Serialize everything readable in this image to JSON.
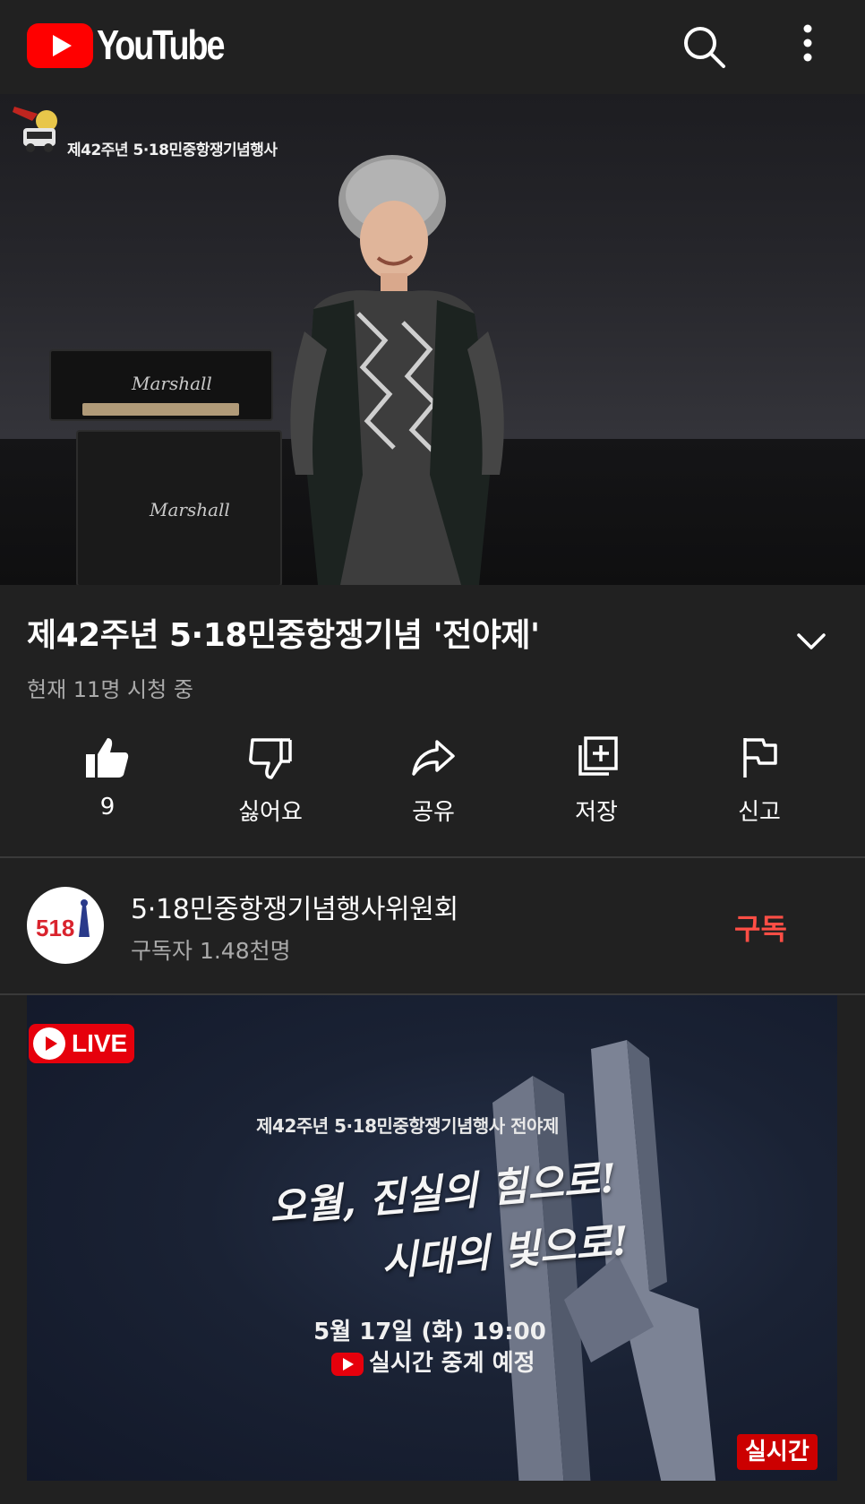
{
  "header": {
    "app_name": "YouTube",
    "logo_icon": "youtube-play-icon",
    "search_icon": "search-icon",
    "more_icon": "more-vert-icon",
    "brand_color": "#ff0000"
  },
  "player": {
    "overlay_caption": "제42주년 5·18민중항쟁기념행사",
    "amp_brand": "Marshall"
  },
  "video": {
    "title": "제42주년 5·18민중항쟁기념 '전야제'",
    "viewers": "현재 11명 시청 중",
    "expand_icon": "chevron-down-icon"
  },
  "actions": [
    {
      "icon": "thumbs-up-icon",
      "label": "9"
    },
    {
      "icon": "thumbs-down-icon",
      "label": "싫어요"
    },
    {
      "icon": "share-icon",
      "label": "공유"
    },
    {
      "icon": "save-playlist-icon",
      "label": "저장"
    },
    {
      "icon": "flag-icon",
      "label": "신고"
    }
  ],
  "channel": {
    "avatar_text": "518",
    "name": "5·18민중항쟁기념행사위원회",
    "subscribers": "구독자 1.48천명",
    "subscribe_label": "구독",
    "subscribe_color": "#ff4e45"
  },
  "live_card": {
    "badge": "LIVE",
    "event": "제42주년 5·18민중항쟁기념행사 전야제",
    "slogan_line1": "오월, 진실의 힘으로!",
    "slogan_line2": "시대의 빛으로!",
    "date": "5월 17일 (화) 19:00",
    "schedule": "실시간 중계 예정",
    "corner_badge": "실시간",
    "live_color": "#e6000c"
  }
}
